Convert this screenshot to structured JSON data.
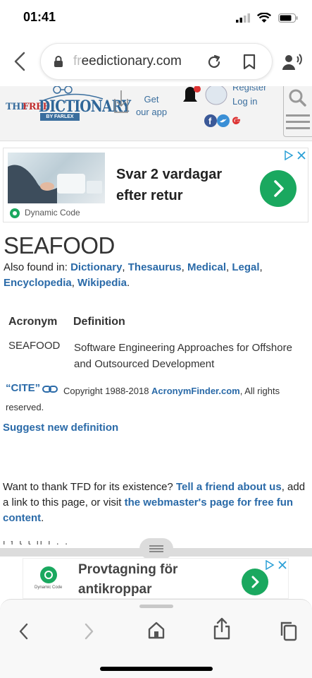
{
  "status_bar": {
    "time": "01:41"
  },
  "browser": {
    "url_faded": "fr",
    "url_main": "eedictionary.com"
  },
  "site_header": {
    "logo_the": "THE",
    "logo_free": "FREE",
    "logo_dictionary": "DICTIONARY",
    "logo_farlex": "BY FARLEX",
    "get_app_line1": "Get",
    "get_app_line2": "our app",
    "register": "Register",
    "login": "Log in"
  },
  "ad_top": {
    "headline": "Svar 2 vardagar efter retur",
    "source": "Dynamic Code"
  },
  "content": {
    "title": "SEAFOOD",
    "found_in_prefix": "Also found in: ",
    "found_in_links": [
      "Dictionary",
      "Thesaurus",
      "Medical",
      "Legal",
      "Encyclopedia",
      "Wikipedia"
    ],
    "table_headers": {
      "acronym": "Acronym",
      "definition": "Definition"
    },
    "table_rows": [
      {
        "acronym": "SEAFOOD",
        "definition": "Software Engineering Approaches for Offshore and Outsourced Development"
      }
    ],
    "cite": "“CITE”",
    "copyright_prefix": "Copyright 1988-2018 ",
    "copyright_link": "AcronymFinder.com",
    "copyright_suffix": ", All rights reserved.",
    "suggest": "Suggest new definition",
    "thank_text_1": "Want to thank TFD for its existence? ",
    "thank_link_1": "Tell a friend about us",
    "thank_text_2": ", add a link to this page, or visit ",
    "thank_link_2": "the webmaster's page for free fun content",
    "thank_text_3": "."
  },
  "ad_bottom": {
    "headline": "Provtagning för antikroppar",
    "source": "Dynamic Code"
  }
}
